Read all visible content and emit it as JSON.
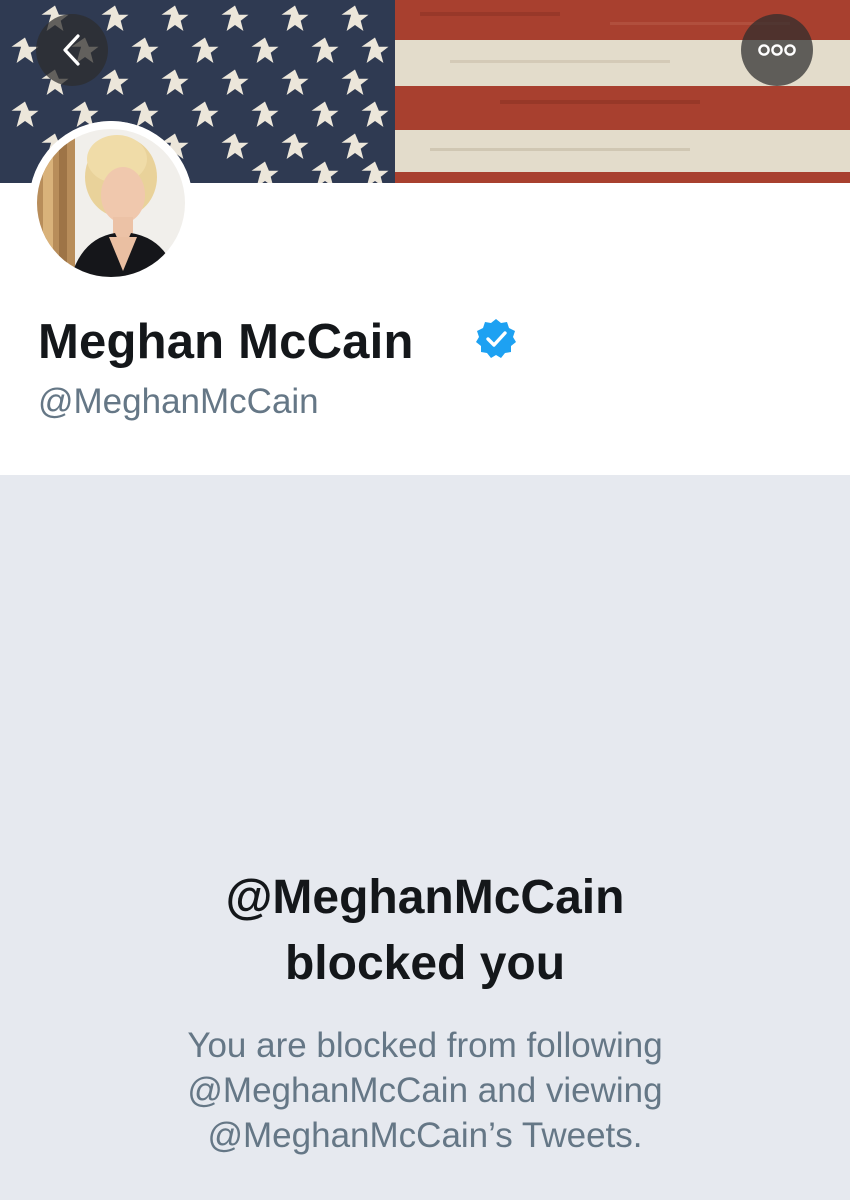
{
  "profile": {
    "name": "Meghan McCain",
    "handle": "@MeghanMcCain",
    "verified": true
  },
  "nav": {
    "back_icon": "chevron-left-icon",
    "more_icon": "ellipsis-icon"
  },
  "blocked": {
    "title_line1": "@MeghanMcCain",
    "title_line2": "blocked you",
    "desc_line1": "You are blocked from following",
    "desc_line2": "@MeghanMcCain and viewing",
    "desc_line3": "@MeghanMcCain’s Tweets."
  },
  "colors": {
    "verified_blue": "#1da1f2",
    "panel_bg": "#e6e9ef",
    "text_primary": "#14171a",
    "text_secondary": "#657786",
    "flag_blue": "#2f3a52",
    "flag_red": "#a8402f",
    "flag_cream": "#e8e2d4"
  }
}
